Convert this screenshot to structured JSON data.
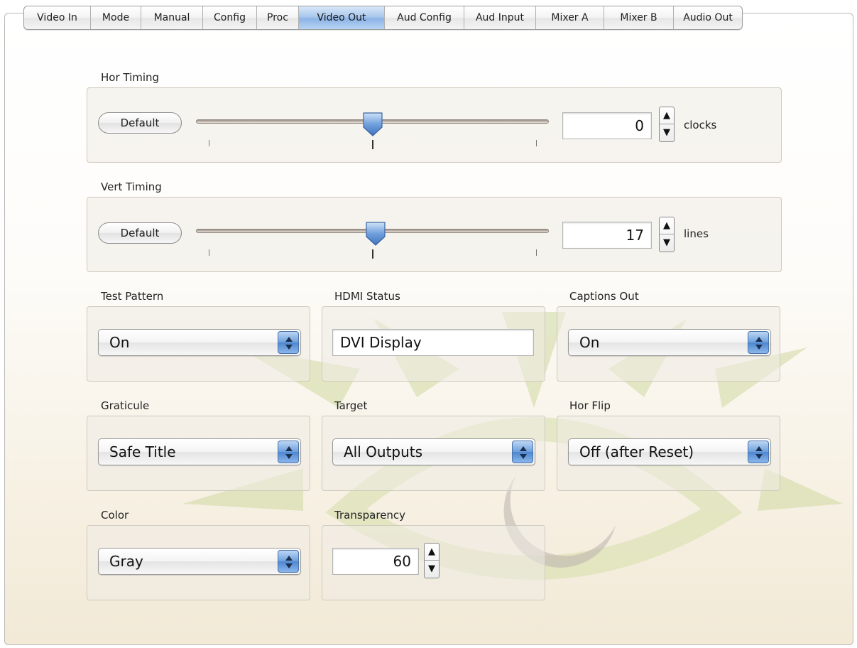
{
  "tabs": [
    {
      "label": "Video In",
      "active": false
    },
    {
      "label": "Mode",
      "active": false
    },
    {
      "label": "Manual",
      "active": false
    },
    {
      "label": "Config",
      "active": false
    },
    {
      "label": "Proc",
      "active": false
    },
    {
      "label": "Video Out",
      "active": true
    },
    {
      "label": "Aud Config",
      "active": false
    },
    {
      "label": "Aud Input",
      "active": false
    },
    {
      "label": "Mixer A",
      "active": false
    },
    {
      "label": "Mixer B",
      "active": false
    },
    {
      "label": "Audio Out",
      "active": false
    }
  ],
  "hor_timing": {
    "label": "Hor Timing",
    "default_label": "Default",
    "value": "0",
    "unit": "clocks",
    "slider_fraction": 0.5
  },
  "vert_timing": {
    "label": "Vert Timing",
    "default_label": "Default",
    "value": "17",
    "unit": "lines",
    "slider_fraction": 0.51
  },
  "test_pattern": {
    "label": "Test Pattern",
    "value": "On"
  },
  "hdmi_status": {
    "label": "HDMI Status",
    "value": "DVI Display"
  },
  "captions_out": {
    "label": "Captions Out",
    "value": "On"
  },
  "graticule": {
    "label": "Graticule",
    "value": "Safe Title"
  },
  "target": {
    "label": "Target",
    "value": "All Outputs"
  },
  "hor_flip": {
    "label": "Hor Flip",
    "value": "Off (after Reset)"
  },
  "color": {
    "label": "Color",
    "value": "Gray"
  },
  "transparency": {
    "label": "Transparency",
    "value": "60"
  },
  "icons": {
    "stepper_up": "▲",
    "stepper_down": "▼"
  },
  "colors": {
    "accent_blue": "#6d9fdc",
    "watermark_green": "#cfd9a0",
    "watermark_gray": "#b9b3ad"
  }
}
